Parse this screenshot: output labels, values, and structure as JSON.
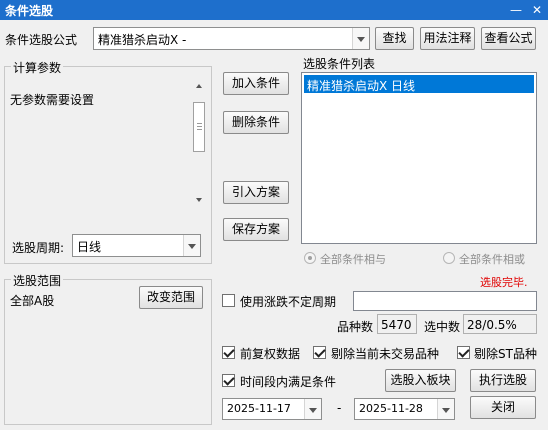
{
  "window": {
    "title": "条件选股",
    "minimize": "—",
    "close": "✕"
  },
  "formula": {
    "label": "条件选股公式",
    "value": "精准猎杀启动X  -",
    "find_button": "查找",
    "usage_button": "用法注释",
    "view_button": "查看公式"
  },
  "params": {
    "group_title": "计算参数",
    "text": "无参数需要设置",
    "period_label": "选股周期:",
    "period_value": "日线"
  },
  "actions": {
    "add": "加入条件",
    "delete": "删除条件",
    "import": "引入方案",
    "save": "保存方案"
  },
  "conditions": {
    "title": "选股条件列表",
    "items": [
      "精准猎杀启动X  日线"
    ],
    "selected_index": 0
  },
  "logic": {
    "all_and": "全部条件相与",
    "all_or": "全部条件相或",
    "selected": "all_and"
  },
  "status": {
    "text": "选股完毕.",
    "color": "#e00000"
  },
  "scope": {
    "group_title": "选股范围",
    "value": "全部A股",
    "change_button": "改变范围"
  },
  "variable_period": {
    "label": "使用涨跌不定周期",
    "checked": false,
    "value": ""
  },
  "stats": {
    "count_label": "品种数",
    "count_value": "5470",
    "selected_label": "选中数",
    "selected_value": "28/0.5%"
  },
  "options": {
    "pre_adjust": {
      "label": "前复权数据",
      "checked": true
    },
    "exclude_untraded": {
      "label": "剔除当前未交易品种",
      "checked": true
    },
    "exclude_st": {
      "label": "剔除ST品种",
      "checked": true
    },
    "time_range": {
      "label": "时间段内满足条件",
      "checked": true
    }
  },
  "buttons": {
    "to_block": "选股入板块",
    "run": "执行选股",
    "close": "关闭"
  },
  "dates": {
    "start": "2025-11-17",
    "separator": "-",
    "end": "2025-11-28"
  },
  "colors": {
    "titlebar": "#1e6fcc",
    "selection": "#0078d7"
  }
}
